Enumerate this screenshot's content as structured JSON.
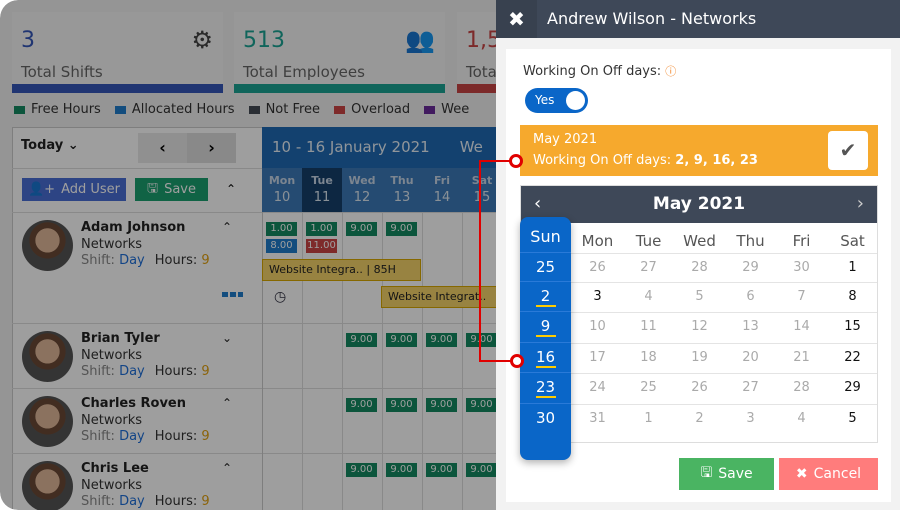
{
  "stats": [
    {
      "value": "3",
      "label": "Total Shifts",
      "color": "#3556b8",
      "icon": "gear-icon"
    },
    {
      "value": "513",
      "label": "Total Employees",
      "color": "#1aa394",
      "icon": "users-icon"
    },
    {
      "value": "1,5",
      "label": "Tota",
      "color": "#c94444",
      "icon": ""
    }
  ],
  "legend": [
    {
      "label": "Free Hours",
      "color": "#148a62"
    },
    {
      "label": "Allocated Hours",
      "color": "#1f7ccc"
    },
    {
      "label": "Not Free",
      "color": "#444b54"
    },
    {
      "label": "Overload",
      "color": "#cc4444"
    },
    {
      "label": "Wee",
      "color": "#6a2a9a"
    }
  ],
  "toolbar": {
    "today": "Today",
    "add_user": "Add User",
    "save": "Save"
  },
  "week": {
    "range": "10 - 16 January 2021",
    "view": "We",
    "days": [
      {
        "d": "Mon",
        "n": "10"
      },
      {
        "d": "Tue",
        "n": "11"
      },
      {
        "d": "Wed",
        "n": "12"
      },
      {
        "d": "Thu",
        "n": "13"
      },
      {
        "d": "Fri",
        "n": "14"
      },
      {
        "d": "Sat",
        "n": "15"
      }
    ]
  },
  "employees": [
    {
      "name": "Adam Johnson",
      "dept": "Networks",
      "shift_label": "Shift:",
      "shift": "Day",
      "hours_label": "Hours:",
      "hours": "9"
    },
    {
      "name": "Brian Tyler",
      "dept": "Networks",
      "shift_label": "Shift:",
      "shift": "Day",
      "hours_label": "Hours:",
      "hours": "9"
    },
    {
      "name": "Charles Roven",
      "dept": "Networks",
      "shift_label": "Shift:",
      "shift": "Day",
      "hours_label": "Hours:",
      "hours": "9"
    },
    {
      "name": "Chris Lee",
      "dept": "Networks",
      "shift_label": "Shift:",
      "shift": "Day",
      "hours_label": "Hours:",
      "hours": "9"
    }
  ],
  "chips": {
    "mon1": "1.00",
    "mon2": "8.00",
    "tue1": "1.00",
    "tue2": "11.00",
    "std": "9.00"
  },
  "tasks": {
    "t1": "Website Integra..   |   85H",
    "t2": "Website Integrat.."
  },
  "panel": {
    "title": "Andrew Wilson - Networks",
    "working_label": "Working On Off days:",
    "toggle": "Yes",
    "toggle_on": true,
    "banner_month": "May 2021",
    "banner_label": "Working On Off days:",
    "banner_days": "2, 9, 16, 23",
    "calendar": {
      "month": "May 2021",
      "weekdays": [
        "Sun",
        "Mon",
        "Tue",
        "Wed",
        "Thu",
        "Fri",
        "Sat"
      ],
      "weeks": [
        [
          "25",
          "26",
          "27",
          "28",
          "29",
          "30",
          "1"
        ],
        [
          "2",
          "3",
          "4",
          "5",
          "6",
          "7",
          "8"
        ],
        [
          "9",
          "10",
          "11",
          "12",
          "13",
          "14",
          "15"
        ],
        [
          "16",
          "17",
          "18",
          "19",
          "20",
          "21",
          "22"
        ],
        [
          "23",
          "24",
          "25",
          "26",
          "27",
          "28",
          "29"
        ],
        [
          "30",
          "31",
          "1",
          "2",
          "3",
          "4",
          "5"
        ]
      ],
      "selected_sundays": [
        "2",
        "9",
        "16",
        "23"
      ]
    },
    "save": "Save",
    "cancel": "Cancel"
  },
  "colors": {
    "accent": "#0a66c8",
    "banner": "#f6a92d",
    "save": "#4ab462",
    "cancel": "#ff7c7c",
    "highlight": "#ffcc00",
    "connector": "#e00000"
  }
}
